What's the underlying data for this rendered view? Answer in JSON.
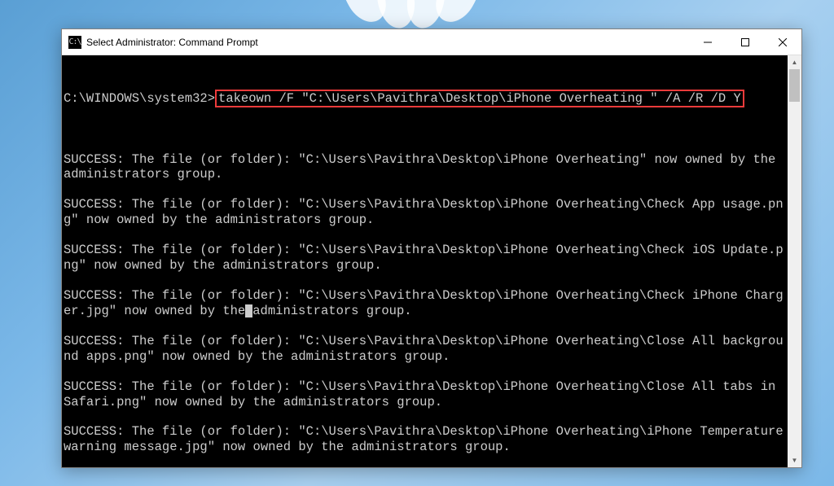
{
  "titlebar": {
    "icon_text": "C:\\",
    "title": "Select Administrator: Command Prompt"
  },
  "terminal": {
    "prompt": "C:\\WINDOWS\\system32>",
    "command": "takeown /F \"C:\\Users\\Pavithra\\Desktop\\iPhone Overheating \" /A /R /D Y",
    "outputs": [
      {
        "text_before_cursor": "SUCCESS: The file (or folder): \"C:\\Users\\Pavithra\\Desktop\\iPhone Overheating\" now owned by the administrators group.",
        "text_after_cursor": "",
        "has_cursor": false
      },
      {
        "text_before_cursor": "SUCCESS: The file (or folder): \"C:\\Users\\Pavithra\\Desktop\\iPhone Overheating\\Check App usage.png\" now owned by the administrators group.",
        "text_after_cursor": "",
        "has_cursor": false
      },
      {
        "text_before_cursor": "SUCCESS: The file (or folder): \"C:\\Users\\Pavithra\\Desktop\\iPhone Overheating\\Check iOS Update.png\" now owned by the administrators group.",
        "text_after_cursor": "",
        "has_cursor": false
      },
      {
        "text_before_cursor": "SUCCESS: The file (or folder): \"C:\\Users\\Pavithra\\Desktop\\iPhone Overheating\\Check iPhone Charger.jpg\" now owned by the",
        "text_after_cursor": "administrators group.",
        "has_cursor": true
      },
      {
        "text_before_cursor": "SUCCESS: The file (or folder): \"C:\\Users\\Pavithra\\Desktop\\iPhone Overheating\\Close All background apps.png\" now owned by the administrators group.",
        "text_after_cursor": "",
        "has_cursor": false
      },
      {
        "text_before_cursor": "SUCCESS: The file (or folder): \"C:\\Users\\Pavithra\\Desktop\\iPhone Overheating\\Close All tabs in Safari.png\" now owned by the administrators group.",
        "text_after_cursor": "",
        "has_cursor": false
      },
      {
        "text_before_cursor": "SUCCESS: The file (or folder): \"C:\\Users\\Pavithra\\Desktop\\iPhone Overheating\\iPhone Temperature warning message.jpg\" now owned by the administrators group.",
        "text_after_cursor": "",
        "has_cursor": false
      }
    ]
  }
}
